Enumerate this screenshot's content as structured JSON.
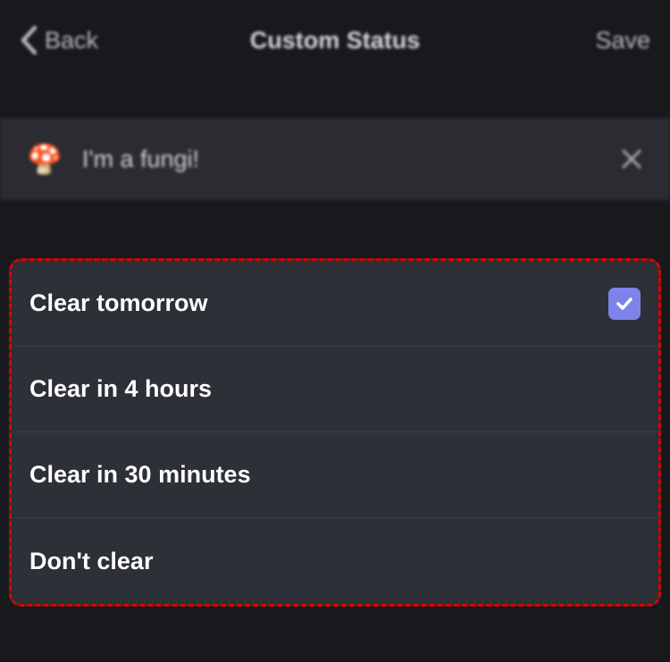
{
  "header": {
    "back_label": "Back",
    "title": "Custom Status",
    "save_label": "Save"
  },
  "status": {
    "emoji": "🍄",
    "text": "I'm a fungi!"
  },
  "clear_options": [
    {
      "label": "Clear tomorrow",
      "selected": true
    },
    {
      "label": "Clear in 4 hours",
      "selected": false
    },
    {
      "label": "Clear in 30 minutes",
      "selected": false
    },
    {
      "label": "Don't clear",
      "selected": false
    }
  ]
}
